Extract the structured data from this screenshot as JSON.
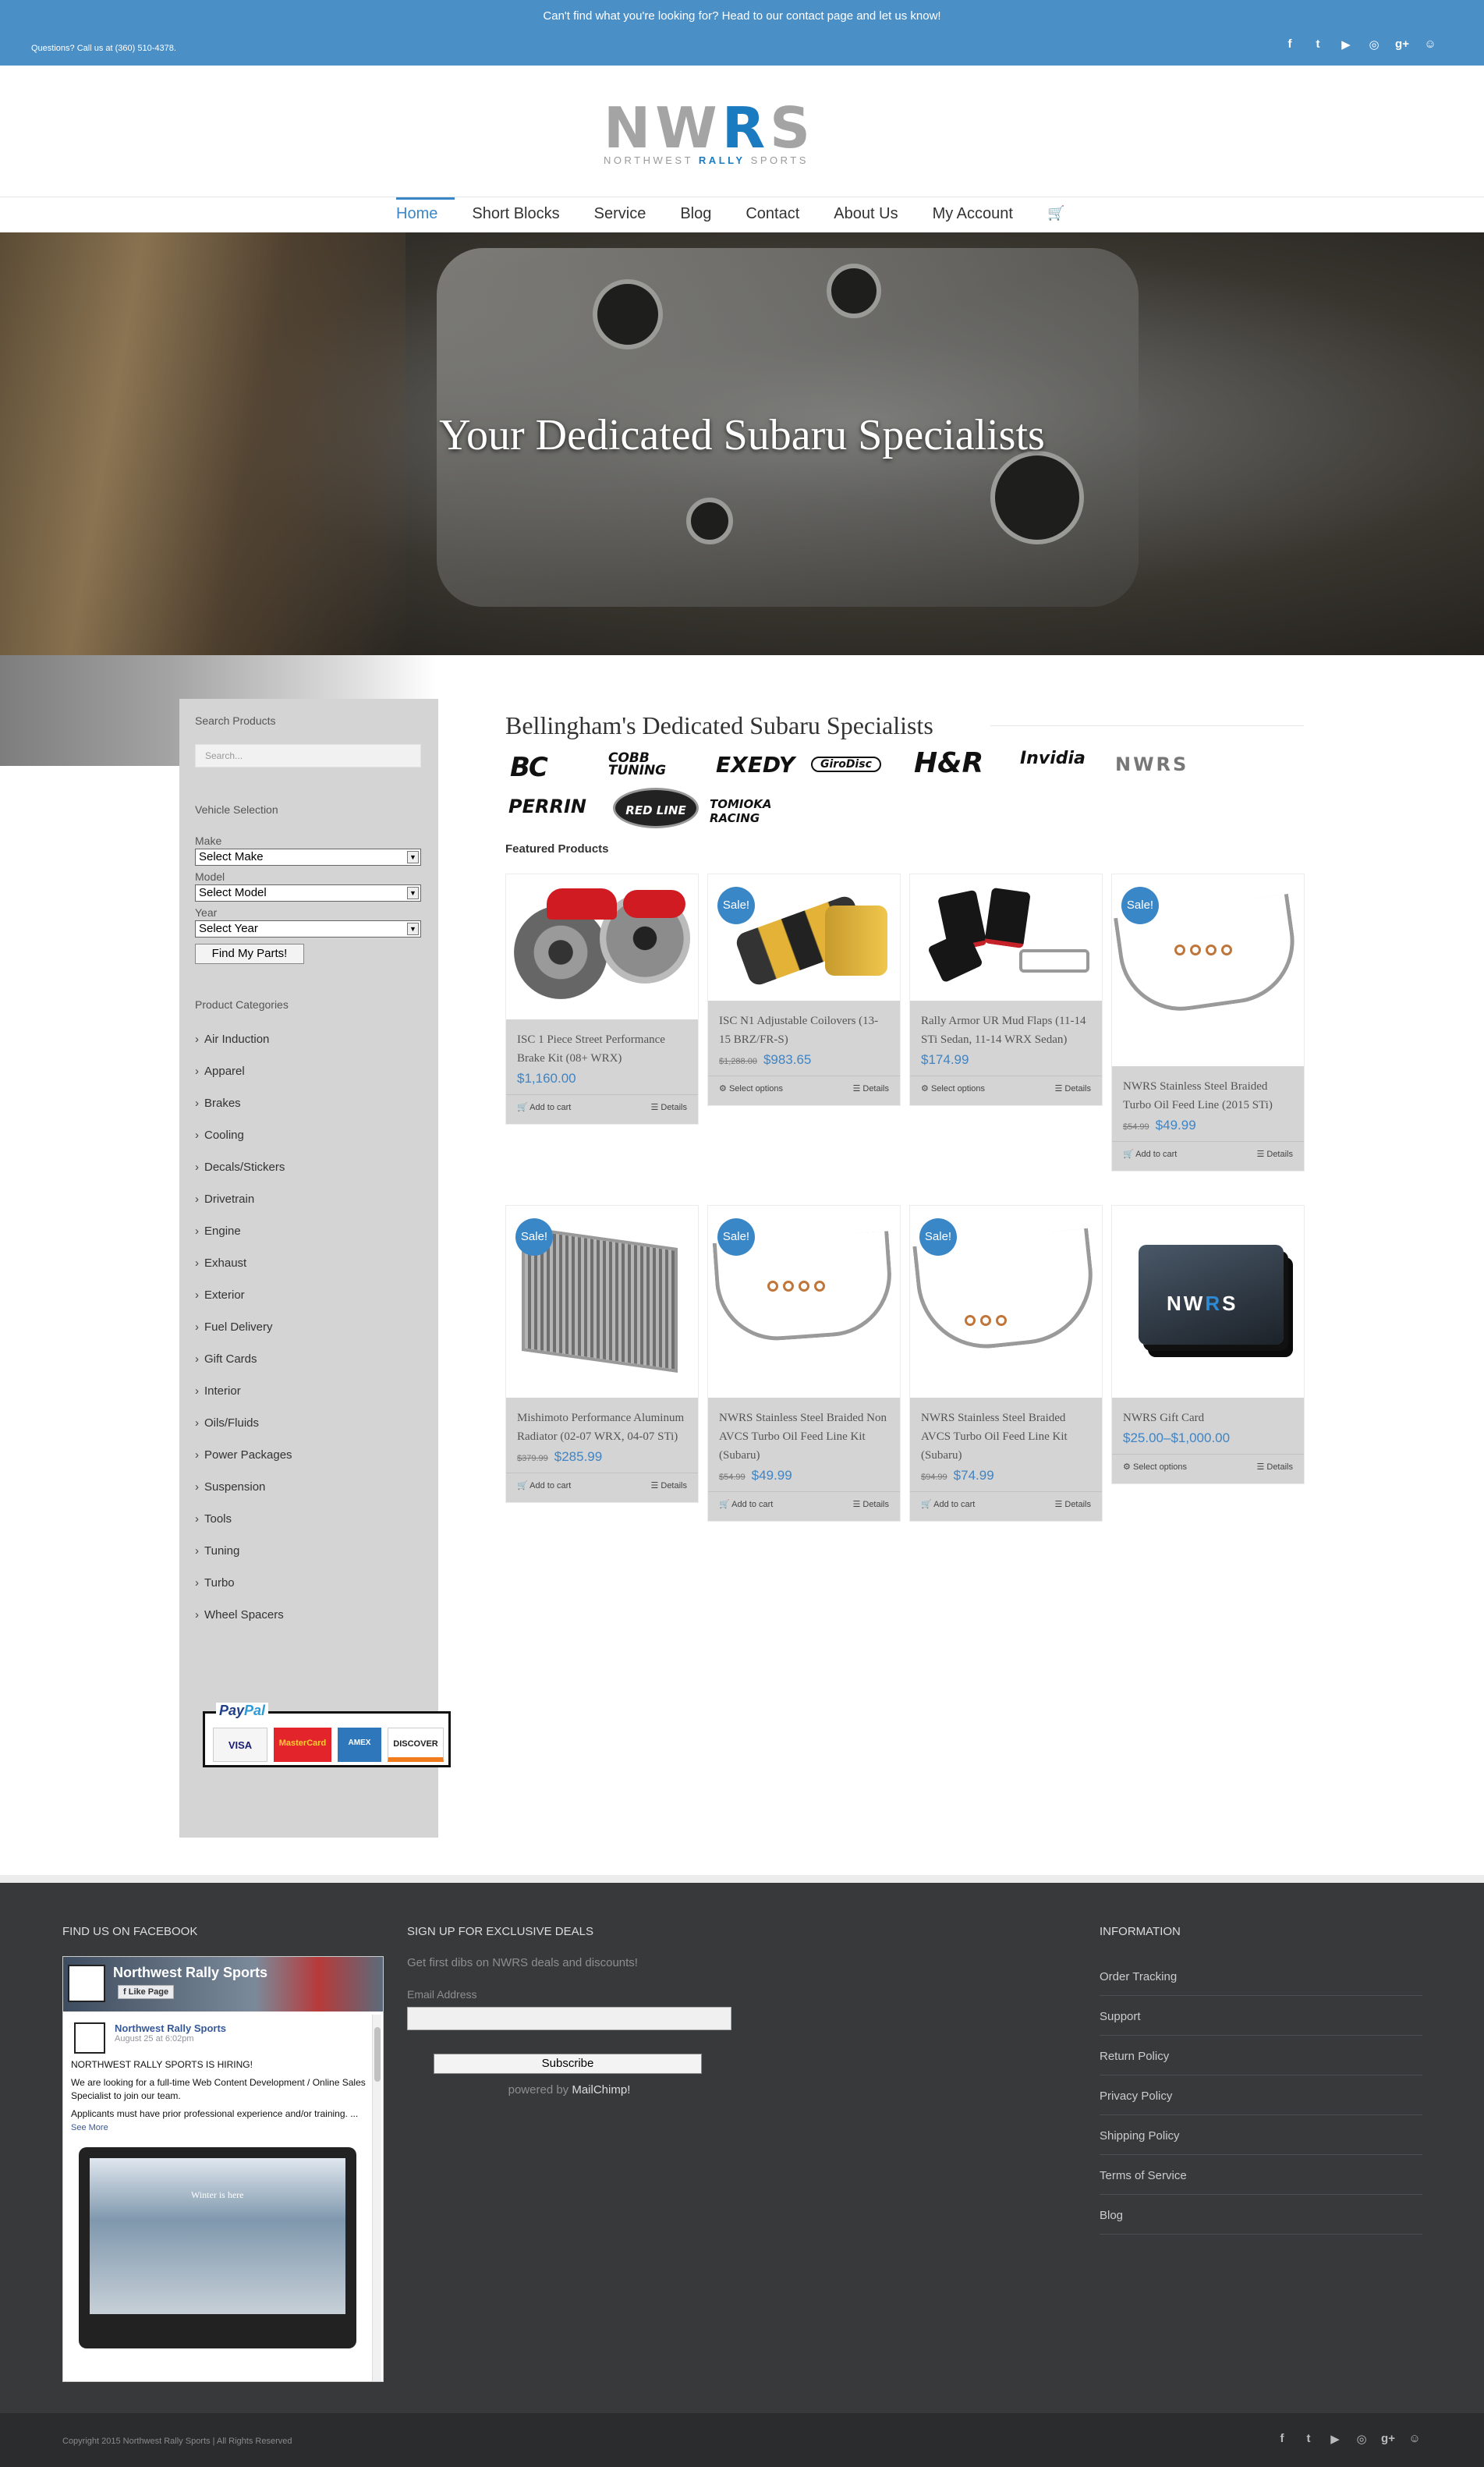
{
  "topbar": {
    "message": "Can't find what you're looking for? Head to our contact page and let us know!",
    "phone": "Questions? Call us at (360) 510-4378.",
    "social": [
      "f",
      "t",
      "▶",
      "◎",
      "g+",
      "☺"
    ]
  },
  "logo": {
    "letters_a": "NW",
    "letters_r": "R",
    "letters_b": "S",
    "sub_a": "NORTHWEST ",
    "sub_b": "RALLY",
    "sub_c": " SPORTS"
  },
  "nav": {
    "items": [
      "Home",
      "Short Blocks",
      "Service",
      "Blog",
      "Contact",
      "About Us",
      "My Account"
    ],
    "cart_icon": "🛒"
  },
  "hero": {
    "headline": "Your Dedicated Subaru Specialists"
  },
  "sidebar": {
    "search_title": "Search Products",
    "search_placeholder": "Search...",
    "vehicle_title": "Vehicle Selection",
    "make_label": "Make",
    "make_value": "Select Make",
    "model_label": "Model",
    "model_value": "Select Model",
    "year_label": "Year",
    "year_value": "Select Year",
    "find_button": "Find My Parts!",
    "categories_title": "Product Categories",
    "categories": [
      "Air Induction",
      "Apparel",
      "Brakes",
      "Cooling",
      "Decals/Stickers",
      "Drivetrain",
      "Engine",
      "Exhaust",
      "Exterior",
      "Fuel Delivery",
      "Gift Cards",
      "Interior",
      "Oils/Fluids",
      "Power Packages",
      "Suspension",
      "Tools",
      "Tuning",
      "Turbo",
      "Wheel Spacers"
    ],
    "paypal_a": "Pay",
    "paypal_b": "Pal",
    "cards": [
      "VISA",
      "MasterCard",
      "AMEX",
      "DISCOVER"
    ]
  },
  "main": {
    "title": "Bellingham's Dedicated Subaru Specialists",
    "brands": [
      "BC",
      "COBB TUNING",
      "EXEDY",
      "GiroDisc",
      "H&R",
      "Invidia",
      "NWRS",
      "PERRIN",
      "RED LINE",
      "TOMIOKA RACING"
    ],
    "featured_title": "Featured Products",
    "sale_label": "Sale!",
    "add_to_cart": "Add to cart",
    "select_options": "Select options",
    "details": "Details",
    "products": [
      {
        "name": "ISC 1 Piece Street Performance Brake Kit (08+ WRX)",
        "old_price": "",
        "price": "$1,160.00"
      },
      {
        "name": "ISC N1 Adjustable Coilovers (13-15 BRZ/FR-S)",
        "old_price": "$1,288.00",
        "price": "$983.65"
      },
      {
        "name": "Rally Armor UR Mud Flaps (11-14 STi Sedan, 11-14 WRX Sedan)",
        "old_price": "",
        "price": "$174.99"
      },
      {
        "name": "NWRS Stainless Steel Braided Turbo Oil Feed Line (2015 STi)",
        "old_price": "$54.99",
        "price": "$49.99"
      },
      {
        "name": "Mishimoto Performance Aluminum Radiator (02-07 WRX, 04-07 STi)",
        "old_price": "$379.99",
        "price": "$285.99"
      },
      {
        "name": "NWRS Stainless Steel Braided Non AVCS Turbo Oil Feed Line Kit (Subaru)",
        "old_price": "$54.99",
        "price": "$49.99"
      },
      {
        "name": "NWRS Stainless Steel Braided AVCS Turbo Oil Feed Line Kit (Subaru)",
        "old_price": "$94.99",
        "price": "$74.99"
      },
      {
        "name": "NWRS Gift Card",
        "old_price": "",
        "price": "$25.00–$1,000.00"
      }
    ]
  },
  "footer": {
    "facebook_title": "FIND US ON FACEBOOK",
    "fb_page_name": "Northwest Rally Sports",
    "fb_like": "Like Page",
    "fb_post_author": "Northwest Rally Sports",
    "fb_post_date": "August 25 at 6:02pm",
    "fb_post_headline": "NORTHWEST RALLY SPORTS IS HIRING!",
    "fb_post_body": "We are looking for a full-time Web Content Development / Online Sales Specialist to join our team.",
    "fb_post_body2": "Applicants must have prior professional experience and/or training. ...",
    "fb_see_more": "See More",
    "fb_screen_text": "Winter is here",
    "deals_title": "SIGN UP FOR EXCLUSIVE DEALS",
    "deals_sub": "Get first dibs on NWRS deals and discounts!",
    "email_label": "Email Address",
    "subscribe": "Subscribe",
    "powered_by": "powered by ",
    "mailchimp": "MailChimp!",
    "info_title": "INFORMATION",
    "info_links": [
      "Order Tracking",
      "Support",
      "Return Policy",
      "Privacy Policy",
      "Shipping Policy",
      "Terms of Service",
      "Blog"
    ],
    "copyright": "Copyright 2015 Northwest Rally Sports | All Rights Reserved",
    "social": [
      "f",
      "t",
      "▶",
      "◎",
      "g+",
      "☺"
    ]
  }
}
